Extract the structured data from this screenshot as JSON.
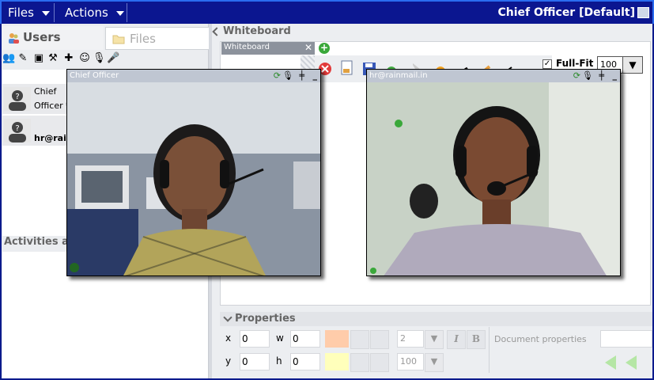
{
  "menu": {
    "files_label": "Files",
    "actions_label": "Actions"
  },
  "window": {
    "title": "Chief Officer [Default]"
  },
  "left_panel": {
    "tabs": [
      {
        "label": "Users"
      },
      {
        "label": "Files"
      }
    ],
    "users": [
      {
        "name_line1": "Chief",
        "name_line2": "Officer *"
      },
      {
        "name_line1": "hr@rain"
      }
    ],
    "activities_label": "Activities and"
  },
  "whiteboard": {
    "header_label": "Whiteboard",
    "tab_label": "Whiteboard",
    "tab_close": "✕",
    "add_symbol": "+",
    "fullfit_label": "Full-Fit",
    "zoom_value": "100",
    "zoom_arrow": "▼"
  },
  "video_windows": [
    {
      "title": "Chief Officer"
    },
    {
      "title": "hr@rainmail.in"
    }
  ],
  "properties": {
    "header_label": "Properties",
    "x_label": "x",
    "x_value": "0",
    "y_label": "y",
    "y_value": "0",
    "w_label": "w",
    "w_value": "0",
    "h_label": "h",
    "h_value": "0",
    "line_width_value": "2",
    "opacity_value": "100",
    "select_arrow": "▼",
    "italic_label": "I",
    "bold_label": "B",
    "document_properties_label": "Document properties"
  },
  "colors": {
    "topbar": "#0b1690",
    "accent_border": "#2a6cf0",
    "fill_swatch": "#ffccaa",
    "line_swatch": "#ffffbb"
  }
}
